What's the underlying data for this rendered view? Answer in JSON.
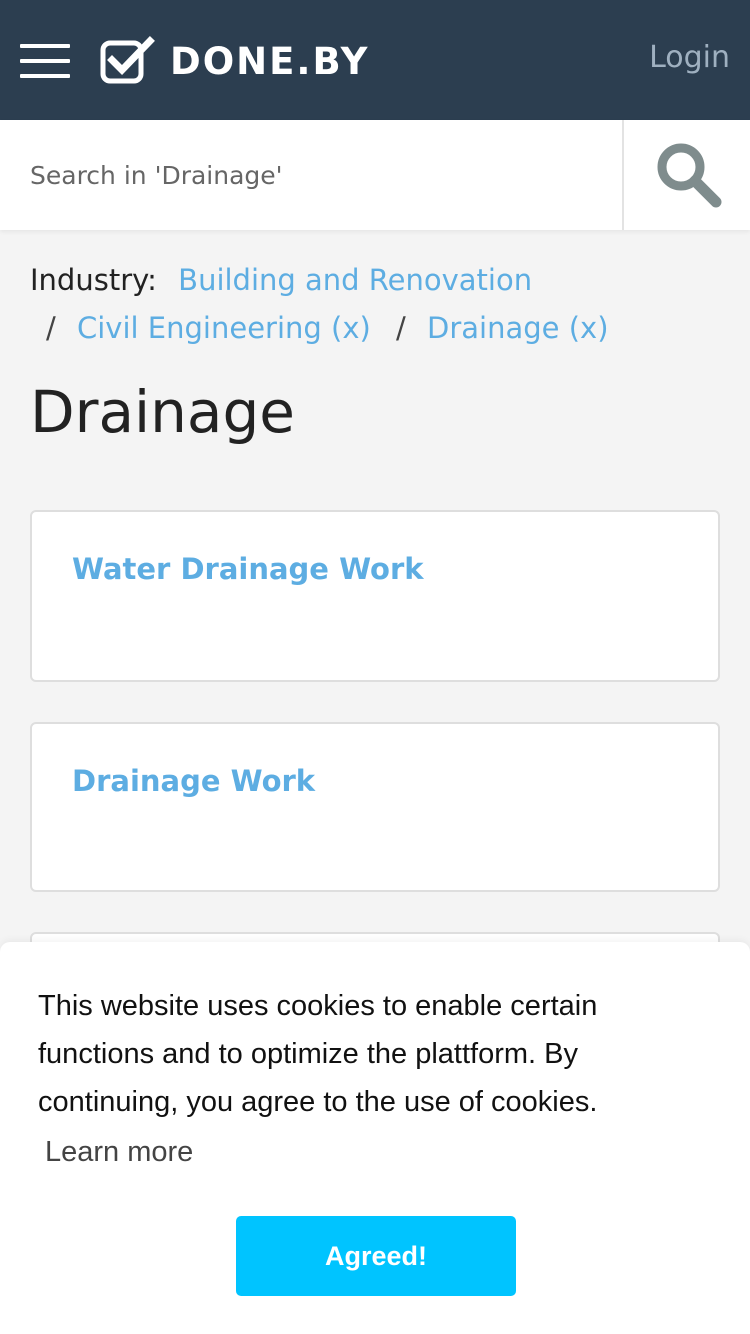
{
  "header": {
    "brand": "DONE.BY",
    "login_label": "Login",
    "menu_icon": "hamburger-menu-icon",
    "logo_icon": "checkbox-check-icon",
    "background_color": "#2c3e50"
  },
  "search": {
    "placeholder": "Search in 'Drainage'",
    "value": "",
    "button_icon": "search-icon"
  },
  "breadcrumb": {
    "label": "Industry:",
    "items": [
      {
        "text": "Building and Renovation"
      },
      {
        "text": "Civil Engineering (x)"
      },
      {
        "text": "Drainage (x)"
      }
    ],
    "separator": "/",
    "link_color": "#5dade2"
  },
  "main": {
    "title": "Drainage",
    "cards": [
      {
        "title": "Water Drainage Work"
      },
      {
        "title": "Drainage Work"
      }
    ]
  },
  "cookie_banner": {
    "message": "This website uses cookies to enable certain functions and to optimize the plattform. By continuing, you agree to the use of cookies.",
    "learn_more": "Learn more",
    "accept_label": "Agreed!",
    "accept_color": "#00c4ff"
  }
}
